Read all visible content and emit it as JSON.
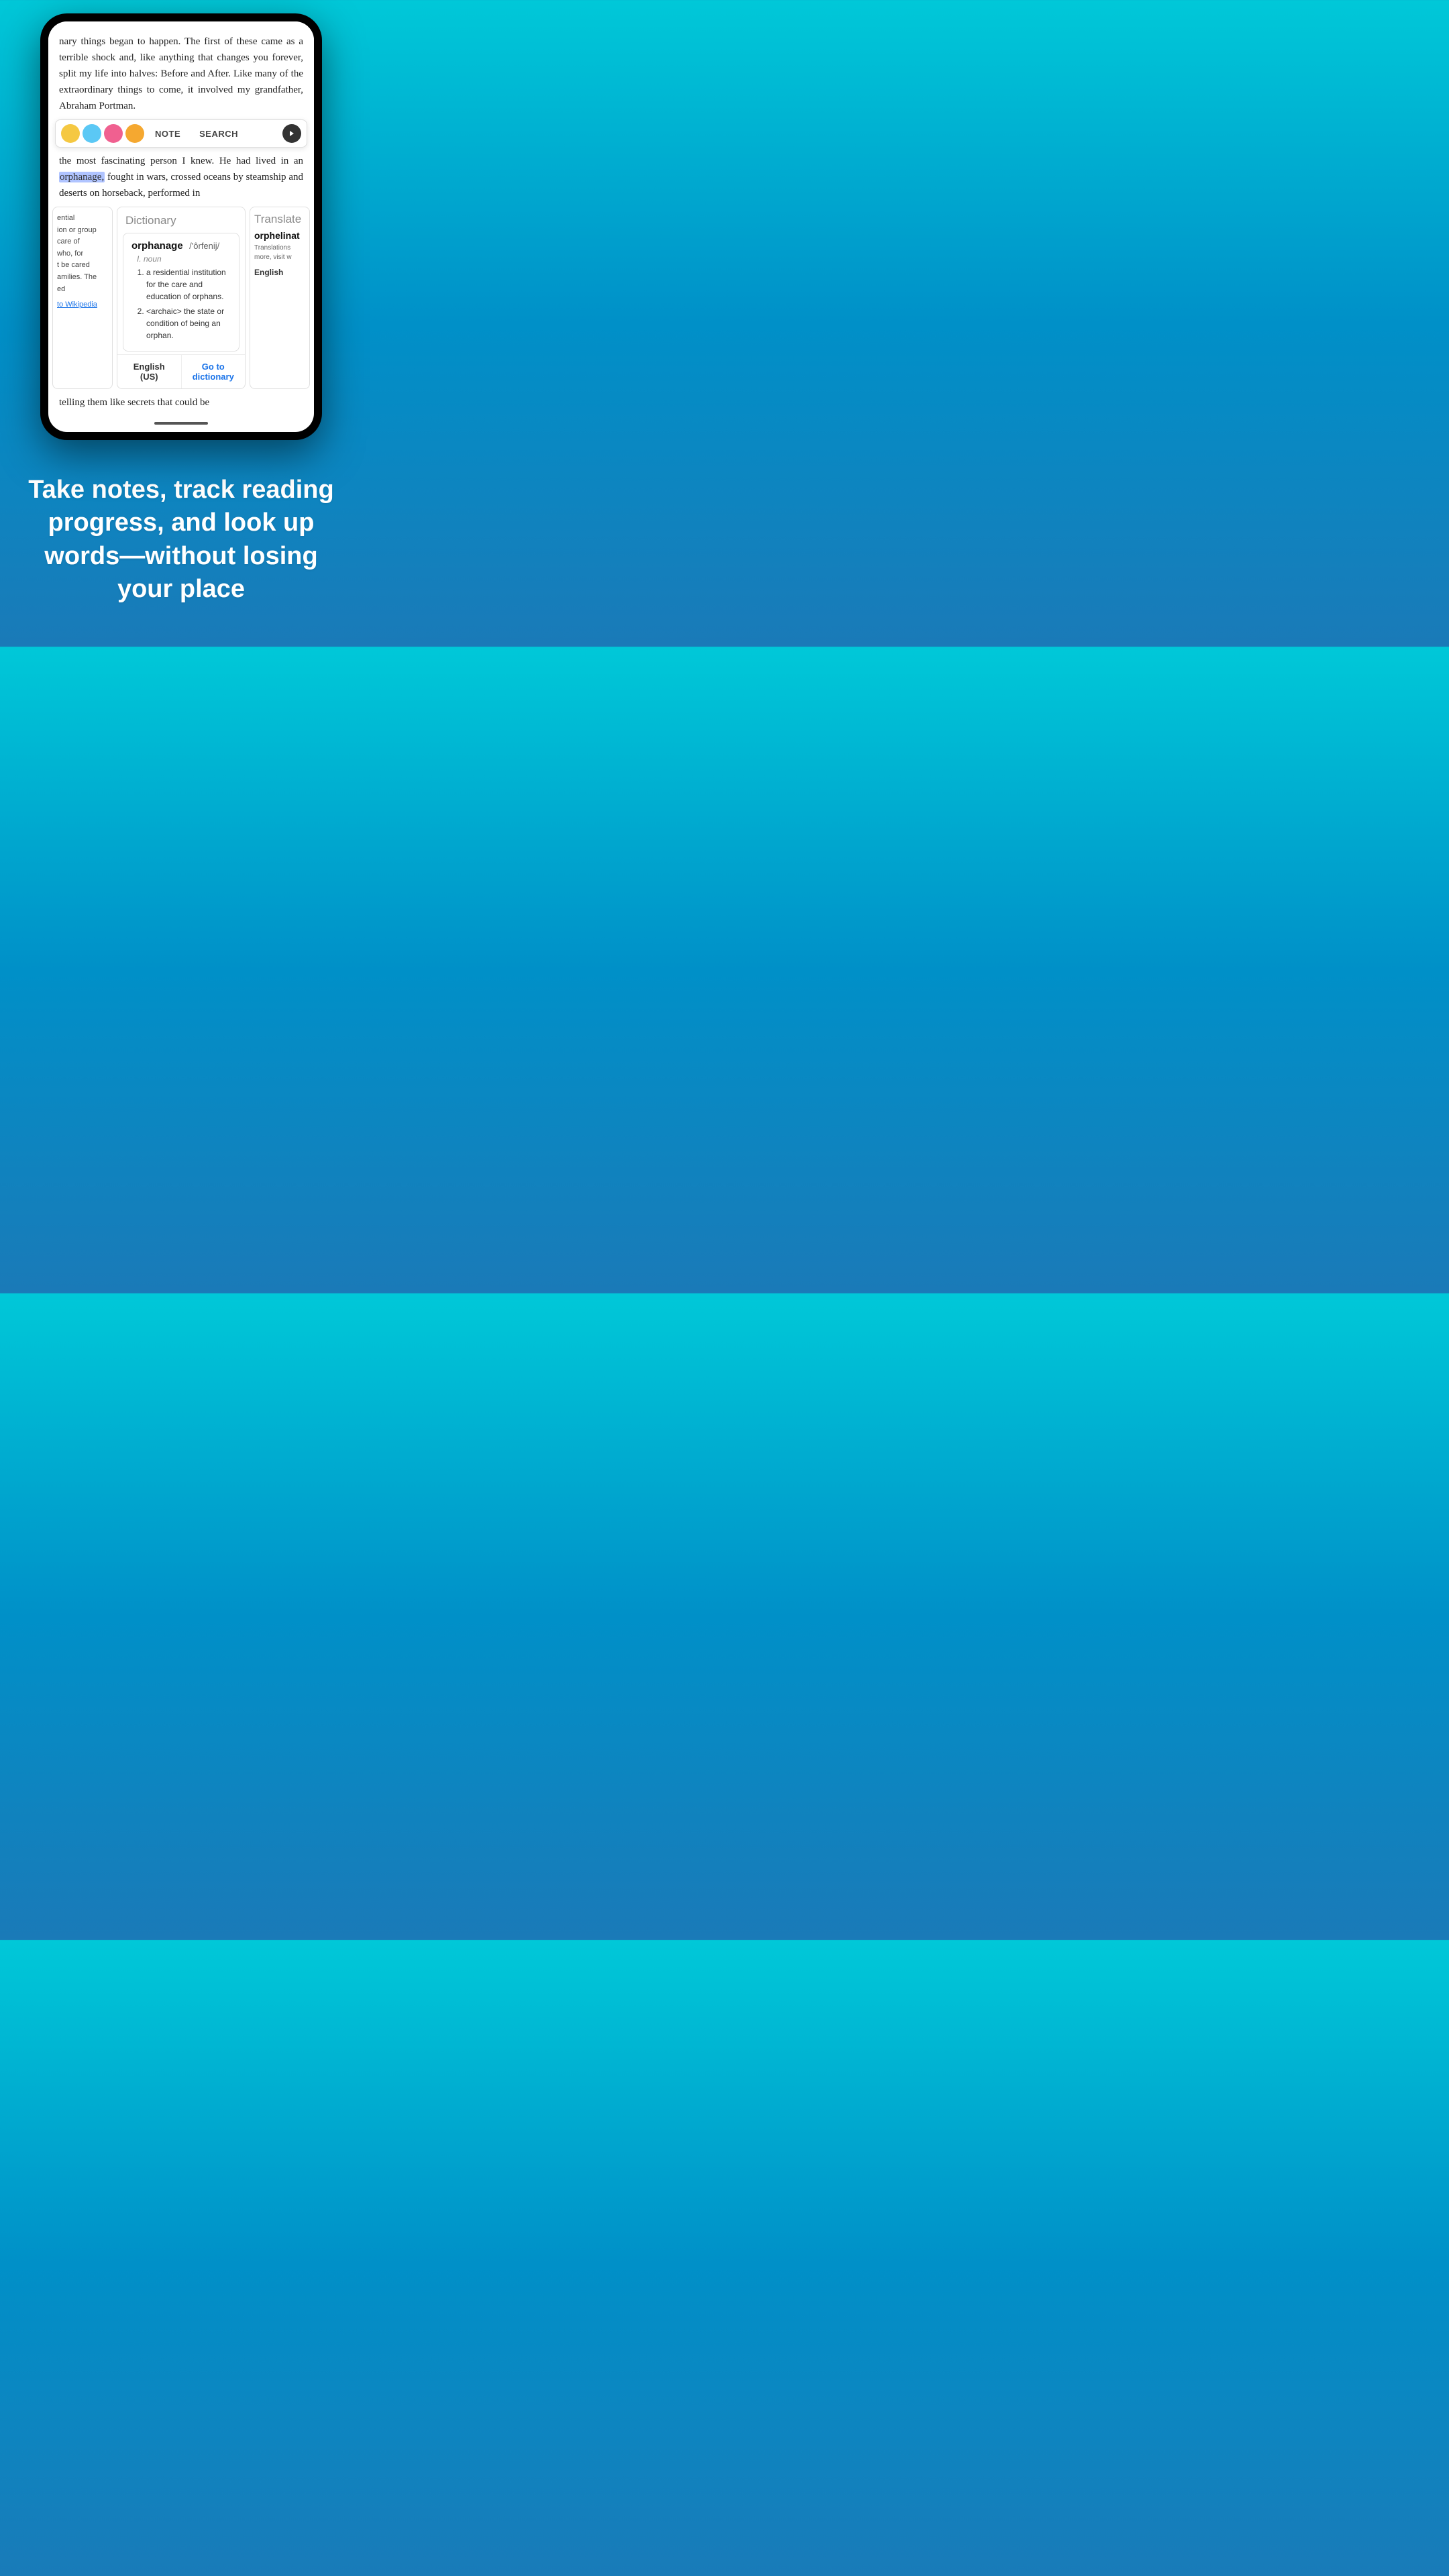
{
  "phone": {
    "book_text_top": "nary things began to happen. The first of these came as a terrible shock and, like anything that changes you forever, split my life into halves: Before and After. Like many of the extraordinary things to come, it involved my grandfather, Abraham Portman.",
    "book_text_highlighted": "the most fascinating person I knew. He had lived in an",
    "highlight_word": "orphanage,",
    "book_text_after_highlight": "fought in wars, crossed oceans by steamship and deserts on horseback, performed in",
    "book_text_bottom": "telling them like secrets that could be"
  },
  "toolbar": {
    "note_label": "NOTE",
    "search_label": "SEARCH",
    "color_yellow": "#F5C842",
    "color_blue": "#5BC8F5",
    "color_pink": "#F06090",
    "color_orange": "#F5A830"
  },
  "left_panel": {
    "text_lines": [
      "ential",
      "ion or group",
      "care of",
      "who, for",
      "t be cared",
      "amilies. The",
      "ed"
    ],
    "wiki_link": "to Wikipedia"
  },
  "dictionary_panel": {
    "header": "Dictionary",
    "word": "orphanage",
    "pronunciation": "/'ôrfenij/",
    "pos": "I. noun",
    "definitions": [
      "a residential institution for the care and education of orphans.",
      "<archaic> the state or condition of being an orphan."
    ],
    "footer_lang": "English (US)",
    "footer_go": "Go to dictionary"
  },
  "translate_panel": {
    "header": "Translate",
    "word": "orphelinat",
    "description": "Translations more, visit w",
    "footer_lang": "English"
  },
  "tagline": {
    "text": "Take notes, track reading progress, and look up words—without losing your place"
  }
}
